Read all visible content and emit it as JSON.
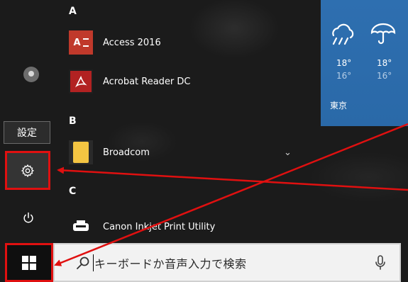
{
  "rail": {
    "tooltip": "設定"
  },
  "apps": {
    "section_a": "A",
    "section_b": "B",
    "section_c": "C",
    "items": [
      {
        "name": "Access 2016",
        "icon": "access-icon",
        "icon_label": "A"
      },
      {
        "name": "Acrobat Reader DC",
        "icon": "acrobat-icon"
      },
      {
        "name": "Broadcom",
        "icon": "folder-icon"
      },
      {
        "name": "Canon Inkjet Print Utility",
        "icon": "printer-icon"
      }
    ]
  },
  "weather": {
    "days": [
      {
        "icon": "cloud-icon",
        "high": "18°",
        "low": "16°"
      },
      {
        "icon": "umbrella-icon",
        "high": "18°",
        "low": "16°"
      }
    ],
    "city": "東京"
  },
  "search": {
    "placeholder": "キーボードか音声入力で検索"
  },
  "colors": {
    "highlight": "#e01010",
    "tile": "#2e6fb0",
    "access": "#c0392b",
    "acrobat": "#b22222",
    "folder": "#f4c542"
  }
}
